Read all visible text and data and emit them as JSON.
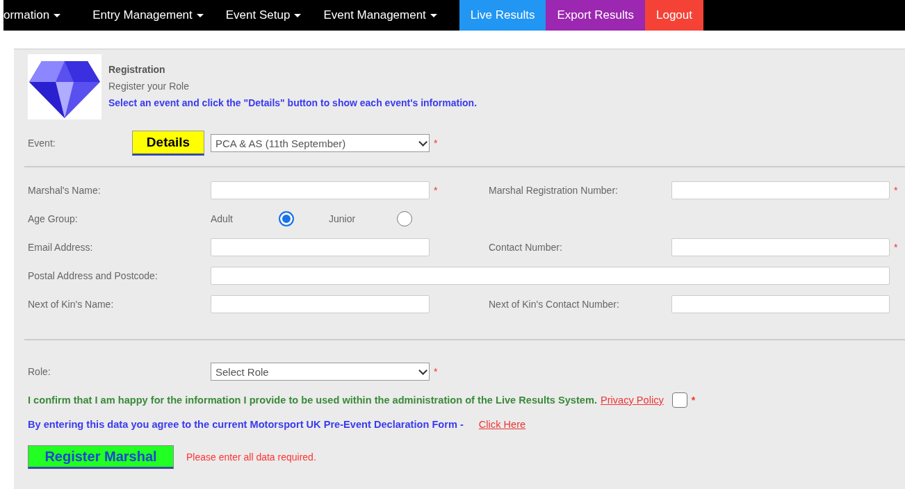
{
  "nav": [
    {
      "label": "ormation",
      "kind": "menu"
    },
    {
      "label": "Entry Management",
      "kind": "menu"
    },
    {
      "label": "Event Setup",
      "kind": "menu"
    },
    {
      "label": "Event Management",
      "kind": "menu"
    },
    {
      "label": "Live Results",
      "kind": "button",
      "color": "#2196f3"
    },
    {
      "label": "Export Results",
      "kind": "button",
      "color": "#9c27b0"
    },
    {
      "label": "Logout",
      "kind": "button",
      "color": "#f44336"
    }
  ],
  "header": {
    "title": "Registration",
    "subtitle": "Register your Role",
    "instruction": "Select an event and click the \"Details\" button to show each event's information."
  },
  "event": {
    "label": "Event:",
    "button": "Details",
    "value": "PCA & AS (11th September)",
    "required": "*"
  },
  "rows": [
    {
      "cells": [
        {
          "kind": "input",
          "label": "Marshal's Name:",
          "required": "*"
        },
        {
          "kind": "input",
          "label": "Marshal Registration Number:",
          "required": "*"
        }
      ]
    },
    {
      "cells": [
        {
          "kind": "radio",
          "label": "Age Group:",
          "options": [
            {
              "label": "Adult",
              "selected": true
            },
            {
              "label": "Junior",
              "selected": false
            }
          ]
        }
      ]
    },
    {
      "cells": [
        {
          "kind": "input",
          "label": "Email Address:"
        },
        {
          "kind": "input",
          "label": "Contact Number:",
          "required": "*"
        }
      ]
    },
    {
      "cells": [
        {
          "kind": "wide",
          "label": "Postal Address and Postcode:"
        }
      ]
    },
    {
      "cells": [
        {
          "kind": "input",
          "label": "Next of Kin's Name:"
        },
        {
          "kind": "input",
          "label": "Next of Kin's Contact Number:"
        }
      ]
    }
  ],
  "role": {
    "label": "Role:",
    "value": "Select Role",
    "required": "*"
  },
  "consent": {
    "text": "I confirm that I am happy for the information I provide to be used within the administration of the Live Results System.",
    "link": "Privacy Policy",
    "checked": false,
    "required": "*"
  },
  "declaration": {
    "text": "By entering this data you agree to the current Motorsport UK Pre-Event Declaration Form -",
    "link": "Click Here"
  },
  "submit": {
    "button": "Register Marshal",
    "message": "Please enter all data required."
  }
}
